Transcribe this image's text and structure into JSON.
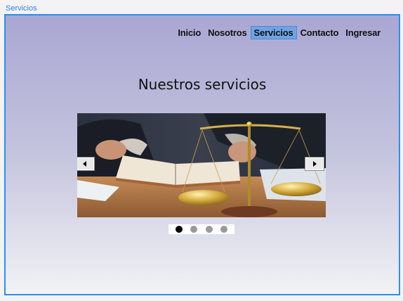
{
  "frame": {
    "label": "Servicios"
  },
  "nav": {
    "items": [
      {
        "label": "Inicio",
        "active": false
      },
      {
        "label": "Nosotros",
        "active": false
      },
      {
        "label": "Servicios",
        "active": true
      },
      {
        "label": "Contacto",
        "active": false
      },
      {
        "label": "Ingresar",
        "active": false
      }
    ]
  },
  "main": {
    "title": "Nuestros servicios"
  },
  "carousel": {
    "prev_icon": "arrow-left-icon",
    "next_icon": "arrow-right-icon",
    "slide_count": 4,
    "active_slide": 0
  },
  "colors": {
    "accent": "#2b8ff0",
    "nav_active": "#6fa3e6"
  }
}
